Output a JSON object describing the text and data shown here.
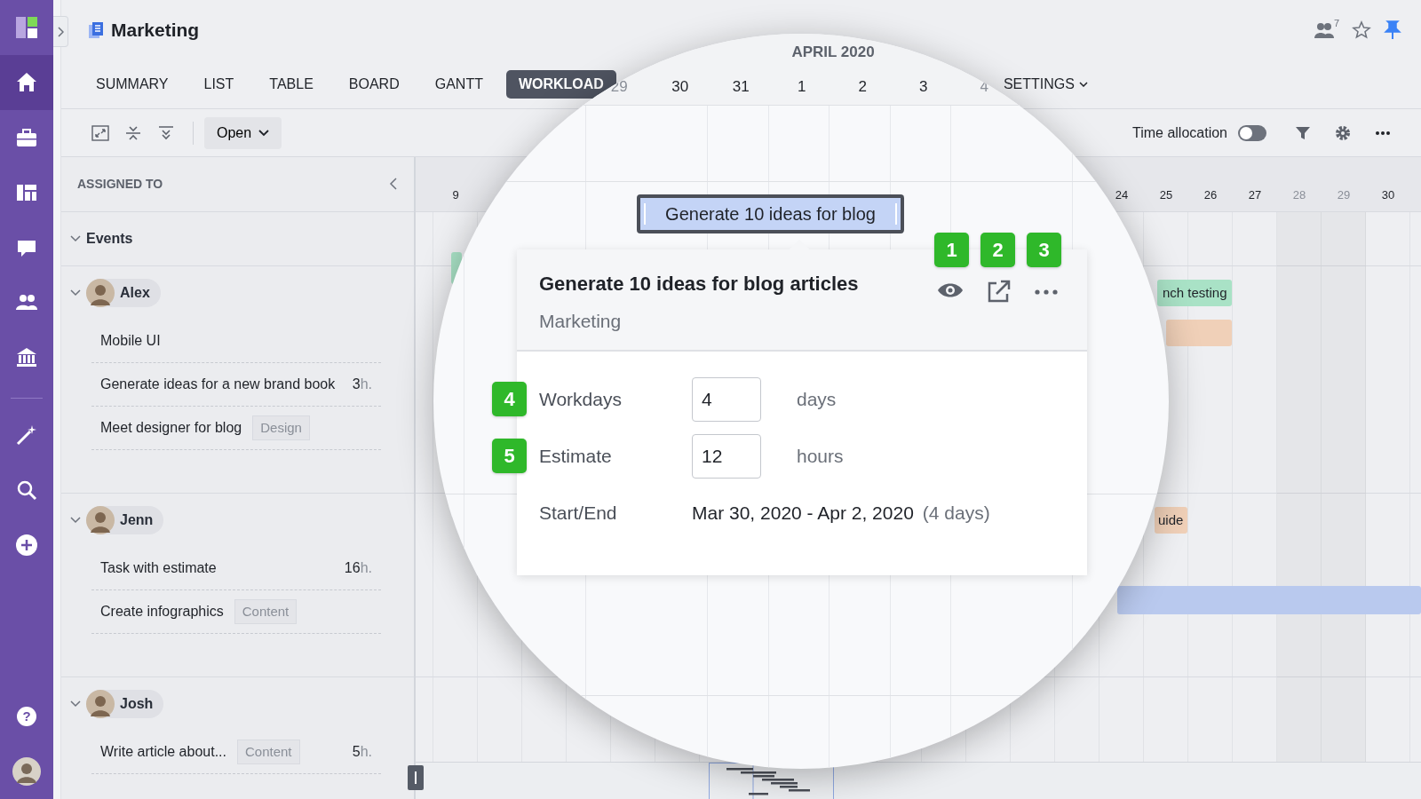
{
  "sidebar": {
    "items": [
      {
        "selected": false
      },
      {
        "selected": true
      },
      {
        "selected": false
      },
      {
        "selected": false
      },
      {
        "selected": false
      },
      {
        "selected": false
      },
      {
        "selected": false
      },
      {
        "selected": false
      },
      {
        "selected": false
      },
      {
        "selected": false
      }
    ],
    "help": "?"
  },
  "header": {
    "title": "Marketing",
    "watchers_count": "7",
    "starred": false,
    "pinned": true
  },
  "tabs": [
    {
      "label": "SUMMARY",
      "selected": false,
      "kind": "plain"
    },
    {
      "label": "LIST",
      "selected": false,
      "kind": "plain"
    },
    {
      "label": "TABLE",
      "selected": false,
      "kind": "plain"
    },
    {
      "label": "BOARD",
      "selected": false,
      "kind": "plain"
    },
    {
      "label": "GANTT",
      "selected": false,
      "kind": "plain"
    },
    {
      "label": "WORKLOAD",
      "selected": true,
      "kind": "plain"
    },
    {
      "label": "SETTINGS",
      "selected": false,
      "kind": "dropdown"
    }
  ],
  "toolbar": {
    "view_filter": "Open",
    "time_allocation": {
      "label": "Time allocation",
      "on": false
    }
  },
  "panel": {
    "heading": "ASSIGNED TO",
    "groups": [
      {
        "name": "Events",
        "kind": "category",
        "expanded": true
      },
      {
        "name": "Alex",
        "kind": "person",
        "expanded": true,
        "tasks": [
          {
            "title": "Mobile UI"
          },
          {
            "title": "Generate ideas for a new brand book",
            "hours": "3",
            "unit": "h."
          },
          {
            "title": "Meet designer for blog",
            "tag": "Design"
          }
        ]
      },
      {
        "name": "Jenn",
        "kind": "person",
        "expanded": true,
        "tasks": [
          {
            "title": "Task with estimate",
            "hours": "16",
            "unit": "h."
          },
          {
            "title": "Create infographics",
            "tag": "Content"
          }
        ]
      },
      {
        "name": "Josh",
        "kind": "person",
        "expanded": true,
        "tasks": [
          {
            "title": "Write article about...",
            "tag": "Content",
            "hours": "5",
            "unit": "h."
          }
        ]
      }
    ]
  },
  "timeline": {
    "days": [
      {
        "label": "9",
        "weekend": false
      },
      {
        "label": "24",
        "weekend": false
      },
      {
        "label": "25",
        "weekend": false
      },
      {
        "label": "26",
        "weekend": false
      },
      {
        "label": "27",
        "weekend": false
      },
      {
        "label": "28",
        "weekend": true
      },
      {
        "label": "29",
        "weekend": true
      },
      {
        "label": "30",
        "weekend": false
      }
    ],
    "bars": [
      {
        "color": "#a9e2c6"
      },
      {
        "label": "nch testing",
        "color": "#a9e2c6"
      },
      {
        "color": "#f0d0b8"
      },
      {
        "label": "uide",
        "color": "#f0d0b8"
      },
      {
        "color": "#b9c9ee"
      }
    ]
  },
  "magnifier": {
    "month": "APRIL 2020",
    "days": [
      {
        "label": "29",
        "weekend": true
      },
      {
        "label": "30",
        "weekend": false
      },
      {
        "label": "31",
        "weekend": false
      },
      {
        "label": "1",
        "weekend": false
      },
      {
        "label": "2",
        "weekend": false
      },
      {
        "label": "3",
        "weekend": false
      },
      {
        "label": "4",
        "weekend": true
      }
    ],
    "bar": {
      "label": "Generate 10 ideas for blog"
    },
    "card": {
      "title": "Generate 10 ideas for blog articles",
      "project": "Marketing",
      "action_markers": [
        "1",
        "2",
        "3"
      ],
      "fields": [
        {
          "marker": "4",
          "label": "Workdays",
          "value": "4",
          "unit": "days"
        },
        {
          "marker": "5",
          "label": "Estimate",
          "value": "12",
          "unit": "hours"
        }
      ],
      "start_end": {
        "label": "Start/End",
        "value": "Mar 30, 2020 - Apr 2, 2020",
        "duration": "(4 days)"
      }
    }
  }
}
